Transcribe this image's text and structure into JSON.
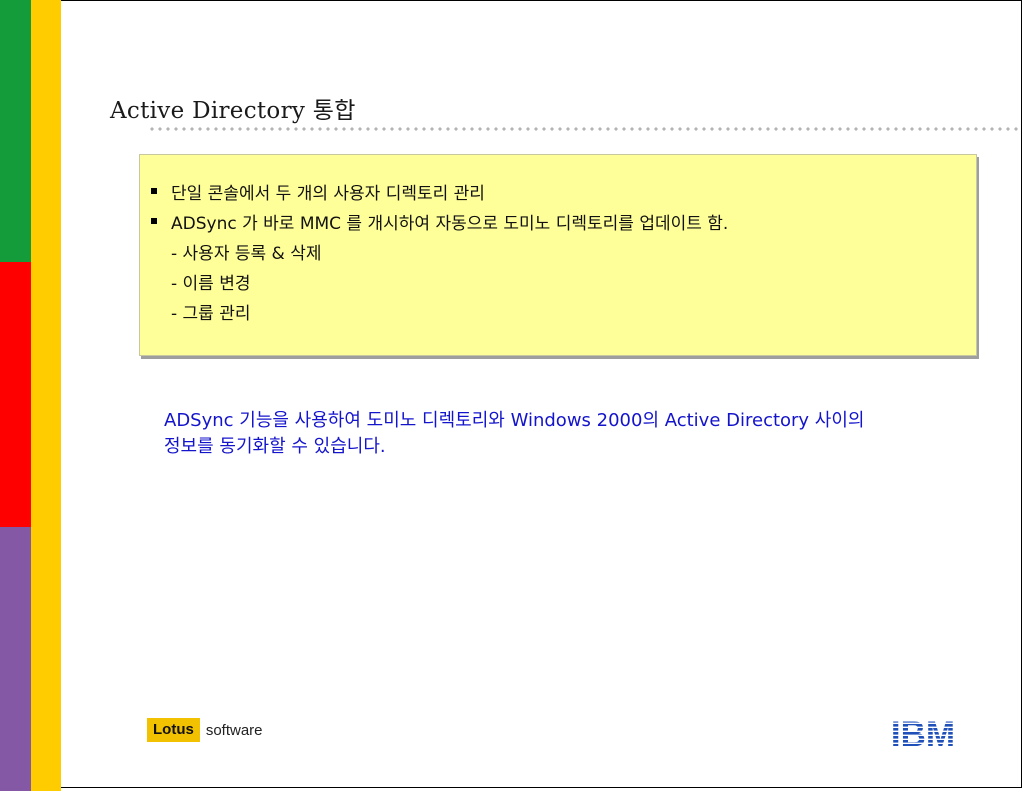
{
  "slide": {
    "title": "Active Directory 통합",
    "bullets": [
      "단일 콘솔에서 두 개의 사용자 디렉토리 관리",
      "ADSync 가 바로 MMC 를 개시하여 자동으로 도미노 디렉토리를 업데이트 함."
    ],
    "sub_items": [
      "- 사용자  등록 & 삭제",
      "- 이름 변경",
      "- 그룹 관리"
    ],
    "description": [
      "ADSync 기능을 사용하여 도미노 디렉토리와 Windows 2000의 Active Directory 사이의",
      "정보를 동기화할 수 있습니다."
    ]
  },
  "footer": {
    "lotus_mark": "Lotus",
    "lotus_word": "software",
    "ibm_logo": "IBM"
  },
  "colors": {
    "stripe_green": "#149C3A",
    "stripe_red": "#FF0000",
    "stripe_purple": "#8558A6",
    "stripe_yellow": "#FFCC00",
    "box_fill": "#FFFF99",
    "description_text": "#1414CC",
    "ibm_blue": "#1F4FB8"
  }
}
